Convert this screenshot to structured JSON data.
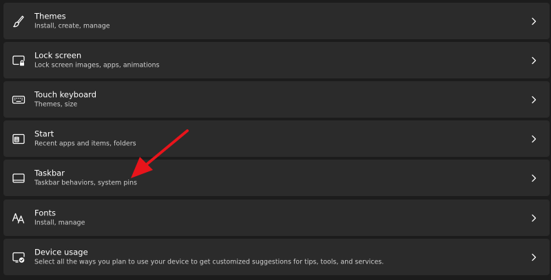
{
  "settings_items": [
    {
      "title": "Themes",
      "subtitle": "Install, create, manage",
      "icon": "brush-icon"
    },
    {
      "title": "Lock screen",
      "subtitle": "Lock screen images, apps, animations",
      "icon": "lock-screen-icon"
    },
    {
      "title": "Touch keyboard",
      "subtitle": "Themes, size",
      "icon": "keyboard-icon"
    },
    {
      "title": "Start",
      "subtitle": "Recent apps and items, folders",
      "icon": "start-icon"
    },
    {
      "title": "Taskbar",
      "subtitle": "Taskbar behaviors, system pins",
      "icon": "taskbar-icon"
    },
    {
      "title": "Fonts",
      "subtitle": "Install, manage",
      "icon": "fonts-icon"
    },
    {
      "title": "Device usage",
      "subtitle": "Select all the ways you plan to use your device to get customized suggestions for tips, tools, and services.",
      "icon": "device-usage-icon"
    }
  ],
  "colors": {
    "background": "#1c1c1c",
    "card": "#2b2b2b",
    "annotation_arrow": "#e8141b"
  }
}
